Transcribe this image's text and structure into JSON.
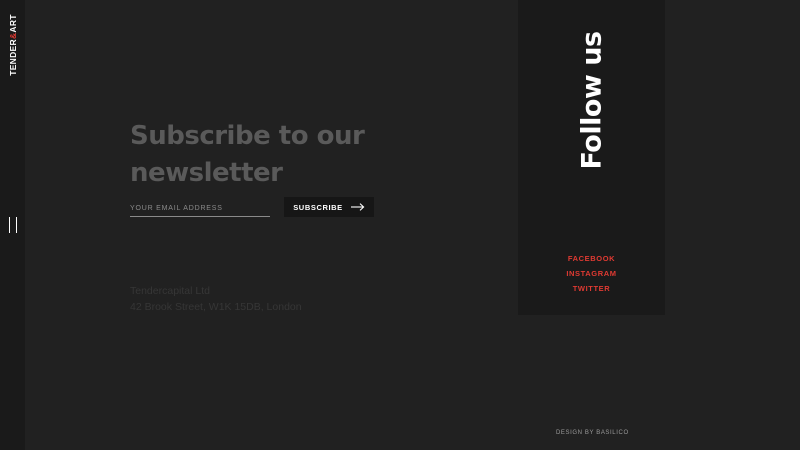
{
  "brand": {
    "logo_part1": "TENDER",
    "logo_amp": "&",
    "logo_part2": "ART",
    "accent_color": "#e03a32"
  },
  "sidebar": {
    "menu_icon": "menu-icon"
  },
  "newsletter": {
    "headline": "Subscribe to our newsletter",
    "email_placeholder": "YOUR EMAIL ADDRESS",
    "email_value": "",
    "subscribe_label": "SUBSCRIBE",
    "subscribe_icon": "arrow-right-icon"
  },
  "company": {
    "name": "Tendercapital Ltd",
    "address": "42 Brook Street, W1K 15DB, London"
  },
  "follow": {
    "title": "Follow us",
    "links": [
      {
        "label": "FACEBOOK"
      },
      {
        "label": "INSTAGRAM"
      },
      {
        "label": "TWITTER"
      }
    ]
  },
  "footer": {
    "credit": "DESIGN BY BASILICO"
  }
}
